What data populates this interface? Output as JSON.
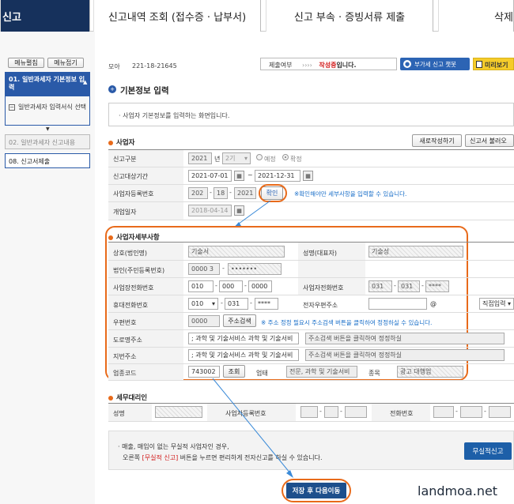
{
  "tabs": [
    {
      "label": "신고"
    },
    {
      "label": "신고내역 조회 (접수증 · 납부서)"
    },
    {
      "label": "신고 부속 · 증빙서류 제출"
    },
    {
      "label": "삭제"
    }
  ],
  "sidebar": {
    "expand_label": "메뉴펼침",
    "collapse_label": "메뉴접기",
    "items": [
      {
        "label": "01. 일반과세자 기본정보 입력"
      },
      {
        "label": "일반과세자 입력서식 선택"
      },
      {
        "label": "02. 일반과세자 신고내용"
      },
      {
        "label": "08. 신고서제출"
      }
    ]
  },
  "topbar": {
    "prefix": "모아",
    "biz_number": "221-18-21645",
    "status_label": "제출여부",
    "status_arrows": "››››",
    "status_value": "작성중",
    "status_suffix": "입니다.",
    "chatbot_label": "부가세 신고 챗봇",
    "preview_label": "미리보기"
  },
  "page_title": "기본정보 입력",
  "info_text": "사업자 기본정보를 입력하는 화면입니다.",
  "business": {
    "title": "사업자",
    "new_button": "새로작성하기",
    "load_button": "신고서 불러오",
    "fields": {
      "type_label": "신고구분",
      "year": "2021",
      "year_suffix": "년",
      "period": "2기",
      "radio_expected": "예정",
      "radio_confirmed": "확정",
      "period_label": "신고대상기간",
      "period_from": "2021-07-01",
      "tilde": "~",
      "period_to": "2021-12-31",
      "brn_label": "사업자등록번호",
      "brn1": "202",
      "brn2": "18",
      "brn3": "2021",
      "confirm_button": "확인",
      "confirm_note": "※확인해야만 세부사항을 입력할 수 있습니다.",
      "open_label": "개업일자",
      "open_date": "2018-04-14"
    }
  },
  "detail": {
    "title": "사업자세부사항",
    "name_label": "상호(법인명)",
    "name_value": "기술서",
    "rep_label": "성명(대표자)",
    "rep_value": "기술성",
    "corp_label": "법인(주민등록번호)",
    "corp1": "0000 3",
    "corp2": "•••••••",
    "phone_label": "사업장전화번호",
    "phone1": "010",
    "phone2": "000",
    "phone3": "0000",
    "biz_phone_label": "사업자전화번호",
    "bp1": "031",
    "bp2": "031",
    "bp3": "****",
    "mobile_label": "휴대전화번호",
    "mob1": "010",
    "mob2": "031",
    "mob3": "****",
    "email_label": "전자우편주소",
    "at": "@",
    "email_select": "직접입력",
    "zip_label": "우편번호",
    "zip_value": "0000",
    "zip_button": "주소검색",
    "zip_note": "※ 주소 정정 필요시 주소검색 버튼을 클릭하여 정정하실 수 있습니다.",
    "road_label": "도로명주소",
    "road_value": "; 과학 및 기술서비스 과학 및 기술서비",
    "road_hint": "주소검색 버튼을 클릭하여 정정하실",
    "jibun_label": "지번주소",
    "jibun_value": "; 과학 및 기술서비스 과학 및 기술서비",
    "jibun_hint": "주소검색 버튼을 클릭하여 정정하실",
    "industry_label": "업종코드",
    "industry_code": "743002",
    "industry_button": "조회",
    "biz_type_label": "업태",
    "biz_type_value": "전문, 과학 및 기술서비",
    "item_label": "종목",
    "item_value": "광고 대행업"
  },
  "agent": {
    "title": "세무대리인",
    "name_label": "성명",
    "brn_label": "사업자등록번호",
    "phone_label": "전화번호"
  },
  "footer": {
    "note_line1": "매출, 매입이 없는 무실적 사업자인 경우,",
    "note_line2_pre": "오른쪽 ",
    "note_line2_red": "[무실적 신고]",
    "note_line2_post": " 버튼을 누르면 편리하게 전자신고를 하실 수 있습니다.",
    "no_result_button": "무실적신고",
    "save_next_button": "저장 후 다음이동"
  },
  "watermark": "landmoa.net",
  "colors": {
    "nav_dark": "#16315c",
    "accent_orange": "#e86a1a",
    "note_blue": "#1a6fc9",
    "button_blue": "#1d5fa8"
  }
}
